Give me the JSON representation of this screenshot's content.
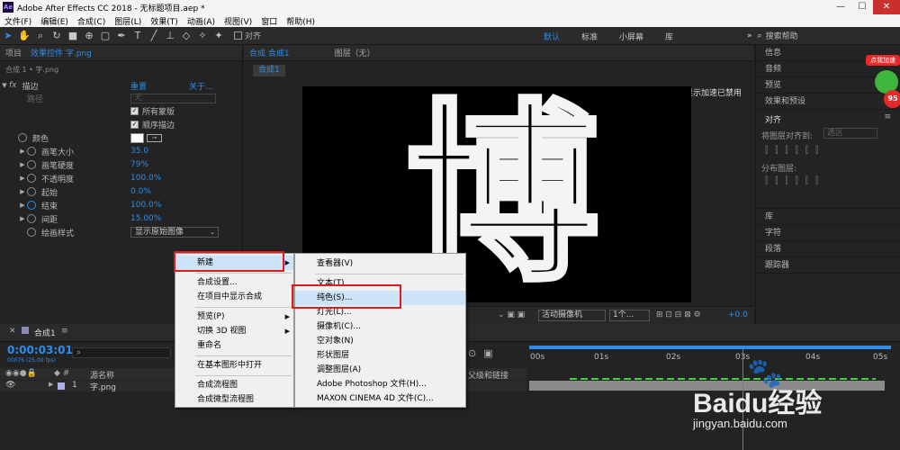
{
  "window": {
    "app_icon": "Ae",
    "title": "Adobe After Effects CC 2018 - 无标题项目.aep *",
    "controls": [
      "—",
      "☐",
      "✕"
    ]
  },
  "menu": [
    "文件(F)",
    "编辑(E)",
    "合成(C)",
    "图层(L)",
    "效果(T)",
    "动画(A)",
    "视图(V)",
    "窗口",
    "帮助(H)"
  ],
  "toolbar": {
    "align_label": "对齐",
    "workspaces": [
      "默认",
      "标准",
      "小屏幕",
      "库"
    ],
    "search_placeholder": "搜索帮助"
  },
  "left_panel": {
    "tabs": [
      "项目",
      "效果控件 字.png"
    ],
    "breadcrumb": "合成 1 • 字.png",
    "effect_name": "描边",
    "reset": "重置",
    "about": "关于...",
    "path_label": "路径",
    "path_value": "无",
    "all_masks": "所有蒙版",
    "sequential": "顺序描边",
    "color_label": "颜色",
    "props": [
      {
        "name": "画笔大小",
        "value": "35.0"
      },
      {
        "name": "画笔硬度",
        "value": "79%"
      },
      {
        "name": "不透明度",
        "value": "100.0%"
      },
      {
        "name": "起始",
        "value": "0.0%"
      },
      {
        "name": "结束",
        "value": "100.0%"
      },
      {
        "name": "间距",
        "value": "15.00%"
      }
    ],
    "paint_style_label": "绘画样式",
    "paint_style_value": "显示原始图像"
  },
  "comp_panel": {
    "tabs": [
      "合成 合成1",
      "图层（无）"
    ],
    "subtab": "合成1",
    "accel_note": "显示加速已禁用",
    "character": "博",
    "camera": "活动摄像机",
    "views": "1个...",
    "exposure": "+0.0"
  },
  "right_panel": {
    "items_top": [
      "信息",
      "音频",
      "预览",
      "效果和预设"
    ],
    "align_title": "对齐",
    "align_to_label": "将图层对齐到:",
    "align_to_value": "选区",
    "distribute_label": "分布图层:",
    "items_bottom": [
      "库",
      "字符",
      "段落",
      "跟踪器"
    ]
  },
  "badge": {
    "text": "点我加速",
    "value": "95"
  },
  "context_menu": {
    "items": [
      "新建",
      "合成设置...",
      "在项目中显示合成",
      "预览(P)",
      "切换 3D 视图",
      "重命名",
      "在基本图形中打开",
      "合成流程图",
      "合成微型流程图"
    ]
  },
  "submenu": {
    "items": [
      "查看器(V)",
      "文本(T)",
      "纯色(S)...",
      "灯光(L)...",
      "摄像机(C)...",
      "空对象(N)",
      "形状图层",
      "调整图层(A)",
      "Adobe Photoshop 文件(H)...",
      "MAXON CINEMA 4D 文件(C)..."
    ]
  },
  "timeline": {
    "tab": "合成1",
    "timecode": "0:00:03:01",
    "frames": "00076 (25.00 fps)",
    "source_name_header": "源名称",
    "parent_header": "父级和链接",
    "layer_index": "1",
    "layer_name": "字.png",
    "ruler_labels": [
      "00s",
      "01s",
      "02s",
      "03s",
      "04s",
      "05s"
    ]
  },
  "watermark": {
    "main": "Baidu经验",
    "url": "jingyan.baidu.com"
  },
  "colors": {
    "accent": "#2d8ceb",
    "highlight": "#e41b1b",
    "menu_bg": "#f0f0f0"
  }
}
